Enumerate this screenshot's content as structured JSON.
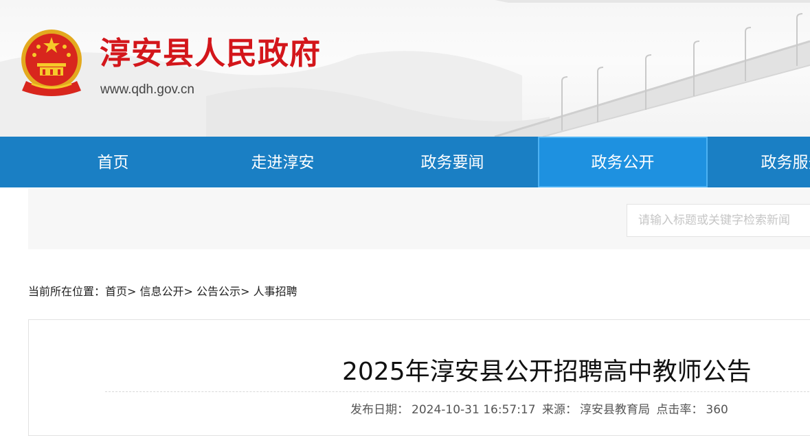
{
  "header": {
    "site_name": "淳安县人民政府",
    "site_url": "www.qdh.gov.cn",
    "brand_color": "#d3161b"
  },
  "nav": {
    "items": [
      {
        "label": "首页",
        "active": false
      },
      {
        "label": "走进淳安",
        "active": false
      },
      {
        "label": "政务要闻",
        "active": false
      },
      {
        "label": "政务公开",
        "active": true
      },
      {
        "label": "政务服务",
        "active": false
      }
    ],
    "bg_color": "#1a7fc4",
    "active_color": "#1e91e0"
  },
  "search": {
    "placeholder": "请输入标题或关键字检索新闻"
  },
  "breadcrumb": {
    "prefix": "当前所在位置：",
    "items": [
      "首页",
      "信息公开",
      "公告公示",
      "人事招聘"
    ],
    "separator": ">"
  },
  "article": {
    "title": "2025年淳安县公开招聘高中教师公告",
    "publish_label": "发布日期：",
    "publish_date": "2024-10-31 16:57:17",
    "source_label": "来源：",
    "source": "淳安县教育局",
    "views_label": "点击率：",
    "views": "360"
  }
}
